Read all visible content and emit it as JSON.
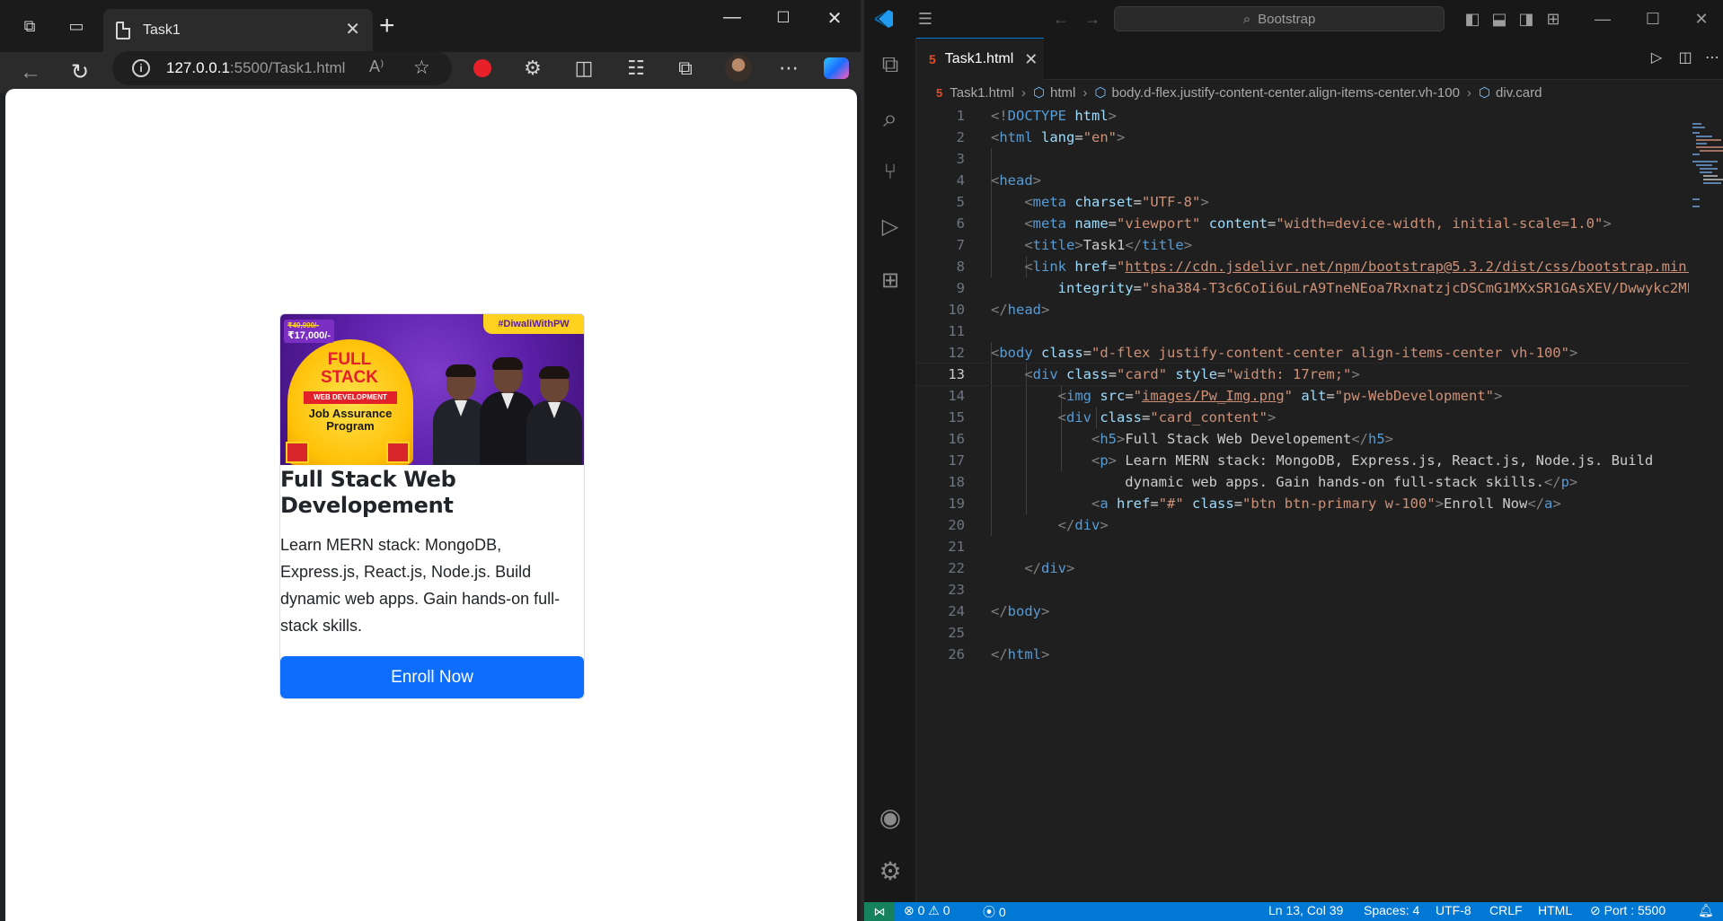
{
  "browser": {
    "tab_title": "Task1",
    "url_host": "127.0.0.1",
    "url_rest": ":5500/Task1.html",
    "page": {
      "banner": {
        "ribbon": "#DiwaliWithPW",
        "old_price": "₹40,000/-",
        "price": "₹17,000/-",
        "full": "FULL STACK",
        "web_dev": "WEB DEVELOPMENT",
        "job": "Job Assurance Program"
      },
      "card_title": "Full Stack Web Developement",
      "card_text": "Learn MERN stack: MongoDB, Express.js, React.js, Node.js. Build dynamic web apps. Gain hands-on full-stack skills.",
      "button_label": "Enroll Now"
    }
  },
  "vscode": {
    "search_placeholder": "Bootstrap",
    "tab_name": "Task1.html",
    "breadcrumb": {
      "file": "Task1.html",
      "html": "html",
      "body": "body.d-flex.justify-content-center.align-items-center.vh-100",
      "div": "div.card"
    },
    "current_line": "13",
    "status": {
      "errors": "0",
      "warnings": "0",
      "ports": "0",
      "cursor": "Ln 13, Col 39",
      "spaces": "Spaces: 4",
      "encoding": "UTF-8",
      "eol": "CRLF",
      "language": "HTML",
      "port": "Port : 5500"
    }
  },
  "colors": {
    "accent": "#0078d4",
    "bootstrap_primary": "#0d6efd",
    "html_icon": "#e44d26"
  }
}
